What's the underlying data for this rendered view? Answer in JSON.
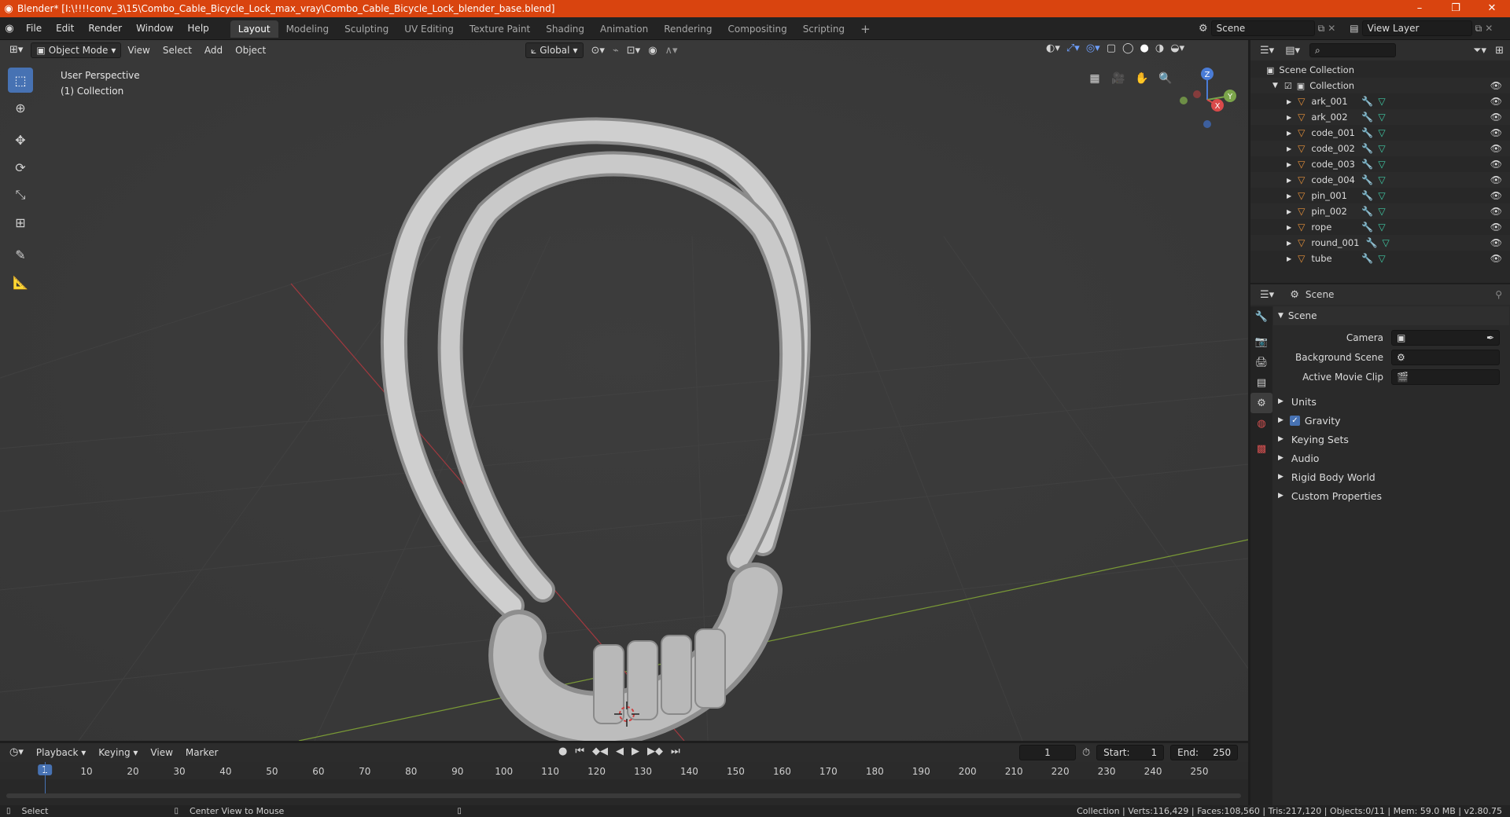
{
  "window": {
    "title": "Blender* [I:\\!!!!conv_3\\15\\Combo_Cable_Bicycle_Lock_max_vray\\Combo_Cable_Bicycle_Lock_blender_base.blend]",
    "minimize": "–",
    "maximize": "❐",
    "close": "✕"
  },
  "menus": [
    "File",
    "Edit",
    "Render",
    "Window",
    "Help"
  ],
  "workspaces": [
    "Layout",
    "Modeling",
    "Sculpting",
    "UV Editing",
    "Texture Paint",
    "Shading",
    "Animation",
    "Rendering",
    "Compositing",
    "Scripting"
  ],
  "add_workspace": "+",
  "scene_field": "Scene",
  "view_layer_field": "View Layer",
  "viewport": {
    "mode": "Object Mode",
    "menus": [
      "View",
      "Select",
      "Add",
      "Object"
    ],
    "transform_orientation": "Global",
    "perspective_label": "User Perspective",
    "collection_label": "(1) Collection",
    "gizmo": {
      "z": "Z",
      "y": "Y",
      "x": "X"
    }
  },
  "outliner": {
    "search_placeholder": "",
    "scene_collection": "Scene Collection",
    "collection": "Collection",
    "items": [
      "ark_001",
      "ark_002",
      "code_001",
      "code_002",
      "code_003",
      "code_004",
      "pin_001",
      "pin_002",
      "rope",
      "round_001",
      "tube"
    ]
  },
  "properties": {
    "context": "Scene",
    "panel": "Scene",
    "camera_label": "Camera",
    "background_scene_label": "Background Scene",
    "active_movie_clip_label": "Active Movie Clip",
    "subpanels": [
      "Units",
      "Gravity",
      "Keying Sets",
      "Audio",
      "Rigid Body World",
      "Custom Properties"
    ],
    "gravity_checked": true
  },
  "timeline": {
    "menus": [
      "Playback",
      "Keying",
      "View",
      "Marker"
    ],
    "current_frame": "1",
    "start_label": "Start:",
    "start": "1",
    "end_label": "End:",
    "end": "250",
    "ticks": [
      "1",
      "10",
      "20",
      "30",
      "40",
      "50",
      "60",
      "70",
      "80",
      "90",
      "100",
      "110",
      "120",
      "130",
      "140",
      "150",
      "160",
      "170",
      "180",
      "190",
      "200",
      "210",
      "220",
      "230",
      "240",
      "250"
    ]
  },
  "status": {
    "select": "Select",
    "center_view": "Center View to Mouse",
    "info": "Collection | Verts:116,429 | Faces:108,560 | Tris:217,120 | Objects:0/11 | Mem: 59.0 MB | v2.80.75"
  },
  "colors": {
    "accent": "#4772b3",
    "titlebar": "#d9440f",
    "object_icon": "#e6913a",
    "mesh_icon": "#3fc9a4",
    "modifier_icon": "#6b9bdc"
  }
}
